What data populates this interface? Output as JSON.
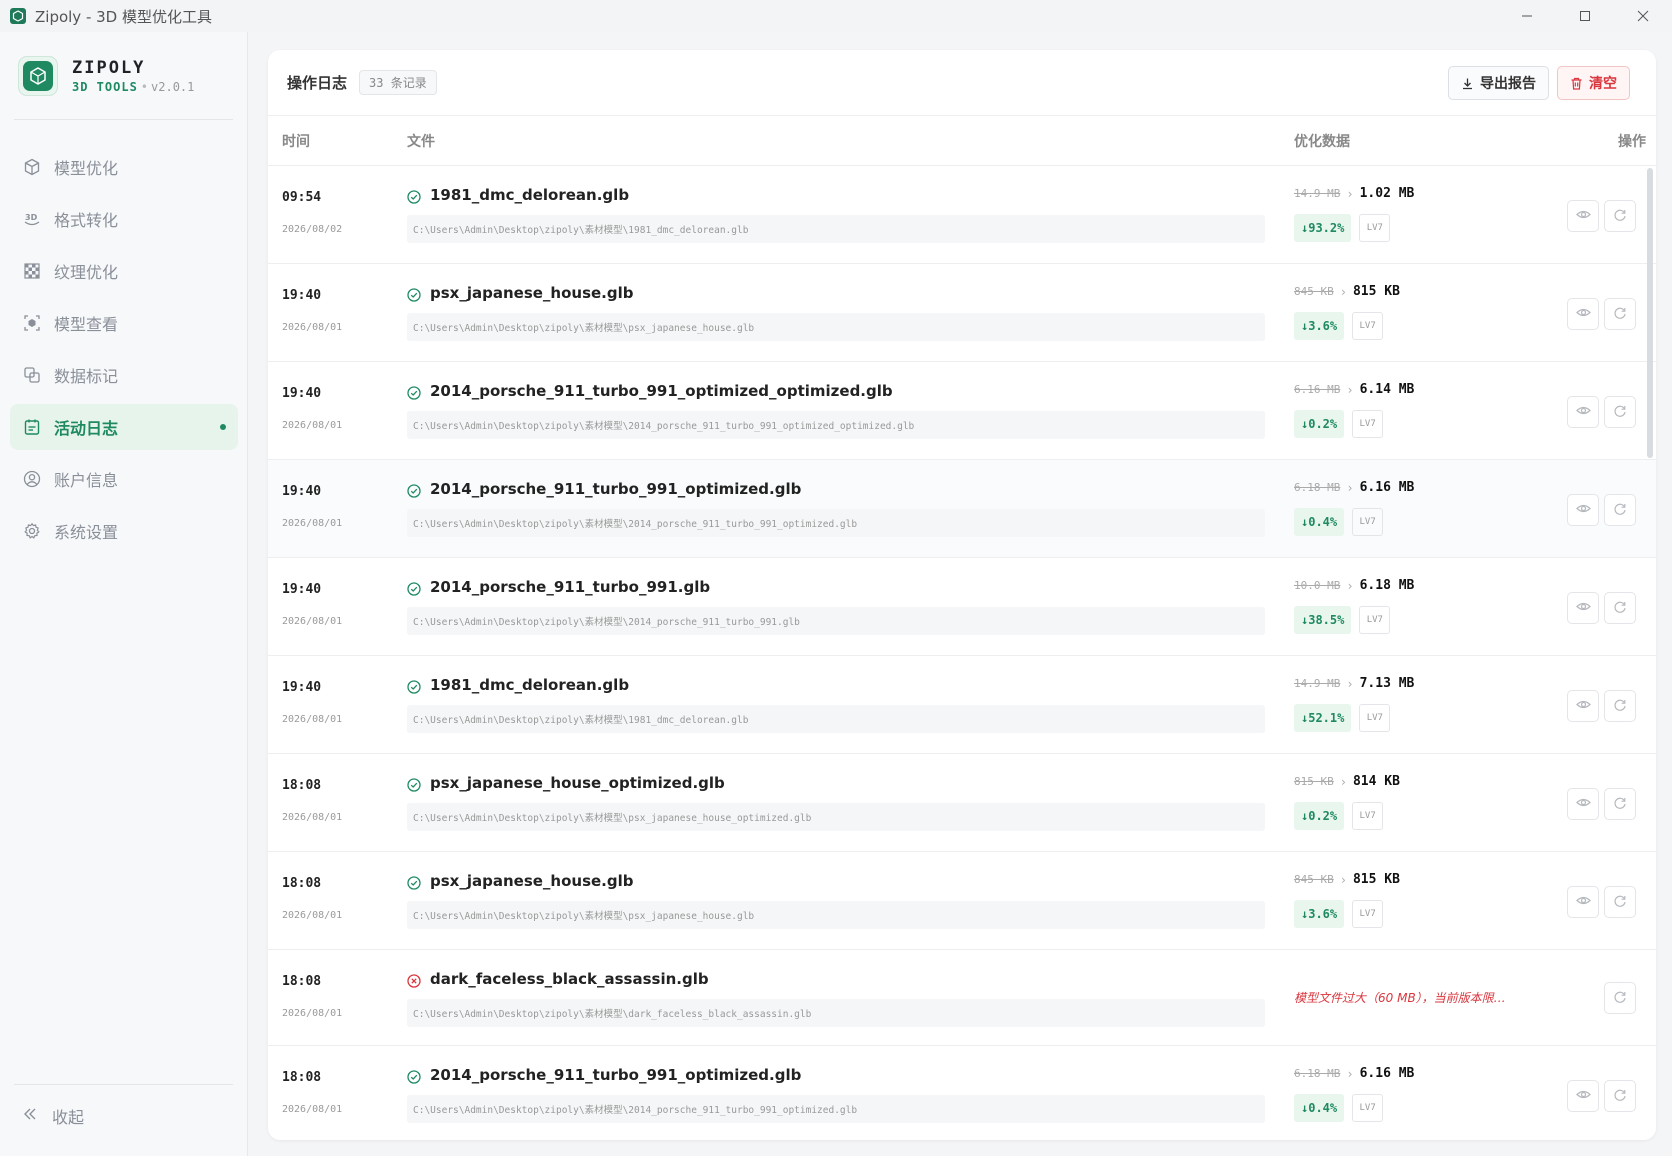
{
  "window": {
    "title": "Zipoly - 3D 模型优化工具",
    "minimize": "—",
    "maximize": "☐",
    "close": "✕"
  },
  "brand": {
    "name": "ZIPOLY",
    "tools": "3D TOOLS",
    "separator": "•",
    "version": "v2.0.1"
  },
  "nav": [
    {
      "label": "模型优化",
      "icon": "cube-icon",
      "active": false
    },
    {
      "label": "格式转化",
      "icon": "3d-icon",
      "active": false
    },
    {
      "label": "纹理优化",
      "icon": "checker-icon",
      "active": false
    },
    {
      "label": "模型查看",
      "icon": "viewer-icon",
      "active": false
    },
    {
      "label": "数据标记",
      "icon": "copy-icon",
      "active": false
    },
    {
      "label": "活动日志",
      "icon": "calendar-icon",
      "active": true
    },
    {
      "label": "账户信息",
      "icon": "user-icon",
      "active": false
    },
    {
      "label": "系统设置",
      "icon": "gear-icon",
      "active": false
    }
  ],
  "collapse_label": "收起",
  "log": {
    "title": "操作日志",
    "count": "33 条记录",
    "export_label": "导出报告",
    "clear_label": "清空",
    "columns": {
      "time": "时间",
      "file": "文件",
      "opt": "优化数据",
      "action": "操作"
    },
    "rows": [
      {
        "time": "09:54",
        "date": "2026/08/02",
        "status": "success",
        "name": "1981_dmc_delorean.glb",
        "path": "C:\\Users\\Admin\\Desktop\\zipoly\\素材模型\\1981_dmc_delorean.glb",
        "before": "14.9 MB",
        "after": "1.02 MB",
        "reduce": "↓93.2%",
        "level": "LV7"
      },
      {
        "time": "19:40",
        "date": "2026/08/01",
        "status": "success",
        "name": "psx_japanese_house.glb",
        "path": "C:\\Users\\Admin\\Desktop\\zipoly\\素材模型\\psx_japanese_house.glb",
        "before": "845 KB",
        "after": "815 KB",
        "reduce": "↓3.6%",
        "level": "LV7"
      },
      {
        "time": "19:40",
        "date": "2026/08/01",
        "status": "success",
        "name": "2014_porsche_911_turbo_991_optimized_optimized.glb",
        "path": "C:\\Users\\Admin\\Desktop\\zipoly\\素材模型\\2014_porsche_911_turbo_991_optimized_optimized.glb",
        "before": "6.16 MB",
        "after": "6.14 MB",
        "reduce": "↓0.2%",
        "level": "LV7"
      },
      {
        "time": "19:40",
        "date": "2026/08/01",
        "status": "success",
        "name": "2014_porsche_911_turbo_991_optimized.glb",
        "path": "C:\\Users\\Admin\\Desktop\\zipoly\\素材模型\\2014_porsche_911_turbo_991_optimized.glb",
        "before": "6.18 MB",
        "after": "6.16 MB",
        "reduce": "↓0.4%",
        "level": "LV7"
      },
      {
        "time": "19:40",
        "date": "2026/08/01",
        "status": "success",
        "name": "2014_porsche_911_turbo_991.glb",
        "path": "C:\\Users\\Admin\\Desktop\\zipoly\\素材模型\\2014_porsche_911_turbo_991.glb",
        "before": "10.0 MB",
        "after": "6.18 MB",
        "reduce": "↓38.5%",
        "level": "LV7"
      },
      {
        "time": "19:40",
        "date": "2026/08/01",
        "status": "success",
        "name": "1981_dmc_delorean.glb",
        "path": "C:\\Users\\Admin\\Desktop\\zipoly\\素材模型\\1981_dmc_delorean.glb",
        "before": "14.9 MB",
        "after": "7.13 MB",
        "reduce": "↓52.1%",
        "level": "LV7"
      },
      {
        "time": "18:08",
        "date": "2026/08/01",
        "status": "success",
        "name": "psx_japanese_house_optimized.glb",
        "path": "C:\\Users\\Admin\\Desktop\\zipoly\\素材模型\\psx_japanese_house_optimized.glb",
        "before": "815 KB",
        "after": "814 KB",
        "reduce": "↓0.2%",
        "level": "LV7"
      },
      {
        "time": "18:08",
        "date": "2026/08/01",
        "status": "success",
        "name": "psx_japanese_house.glb",
        "path": "C:\\Users\\Admin\\Desktop\\zipoly\\素材模型\\psx_japanese_house.glb",
        "before": "845 KB",
        "after": "815 KB",
        "reduce": "↓3.6%",
        "level": "LV7"
      },
      {
        "time": "18:08",
        "date": "2026/08/01",
        "status": "error",
        "name": "dark_faceless_black_assassin.glb",
        "path": "C:\\Users\\Admin\\Desktop\\zipoly\\素材模型\\dark_faceless_black_assassin.glb",
        "error": "模型文件过大（60 MB），当前版本限…"
      },
      {
        "time": "18:08",
        "date": "2026/08/01",
        "status": "success",
        "name": "2014_porsche_911_turbo_991_optimized.glb",
        "path": "C:\\Users\\Admin\\Desktop\\zipoly\\素材模型\\2014_porsche_911_turbo_991_optimized.glb",
        "before": "6.18 MB",
        "after": "6.16 MB",
        "reduce": "↓0.4%",
        "level": "LV7"
      }
    ]
  },
  "colors": {
    "accent": "#1f8a62",
    "danger": "#d9363e",
    "success_bg": "#e9f6ee"
  }
}
